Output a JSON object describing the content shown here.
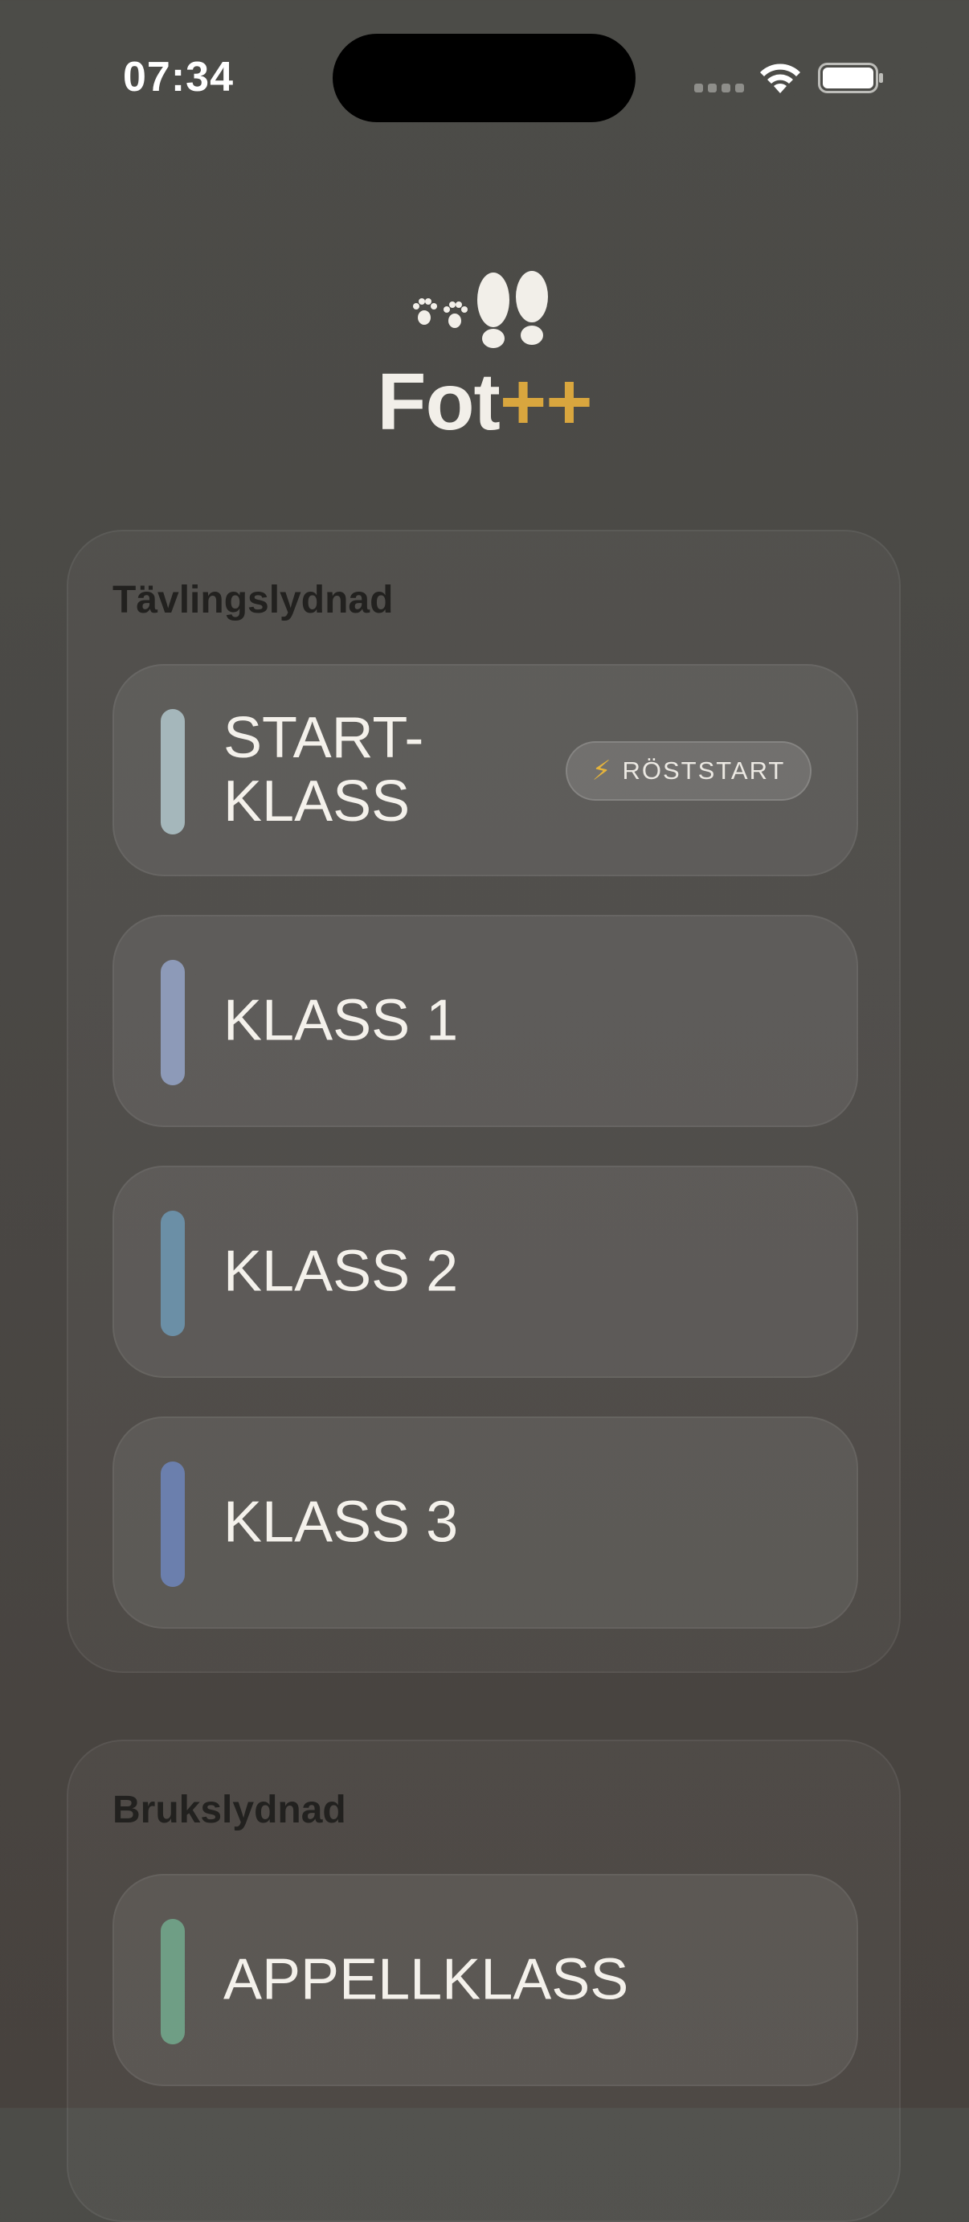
{
  "status_bar": {
    "time": "07:34"
  },
  "header": {
    "title_main": "Fot",
    "title_accent": "++",
    "accent_color": "#d9a63e"
  },
  "sections": [
    {
      "label": "Tävlingslydnad",
      "classes": [
        {
          "label": "START-\nKLASS",
          "color": "#a5b7bb",
          "badge": "RÖSTSTART",
          "badge_icon": "lightning-icon"
        },
        {
          "label": "KLASS 1",
          "color": "#8d9ab8"
        },
        {
          "label": "KLASS 2",
          "color": "#6b8fa6"
        },
        {
          "label": "KLASS 3",
          "color": "#6b7fad"
        }
      ]
    },
    {
      "label": "Brukslydnad",
      "classes": [
        {
          "label": "APPELLKLASS",
          "color": "#6f9e85"
        }
      ]
    }
  ]
}
